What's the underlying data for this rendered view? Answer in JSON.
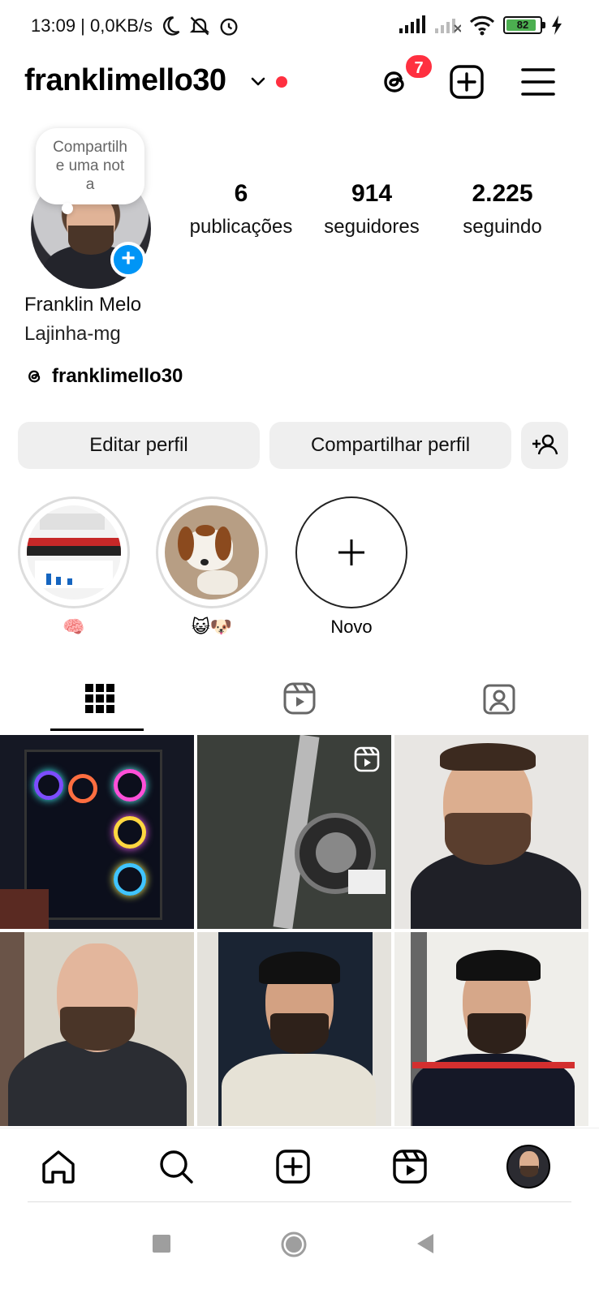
{
  "status_bar": {
    "time_speed": "13:09 | 0,0KB/s",
    "battery_level": "82"
  },
  "header": {
    "username": "franklimello30",
    "threads_badge_count": "7"
  },
  "note": {
    "placeholder": "Compartilhe uma nota"
  },
  "stats": [
    {
      "value": "6",
      "label": "publicações"
    },
    {
      "value": "914",
      "label": "seguidores"
    },
    {
      "value": "2.225",
      "label": "seguindo"
    }
  ],
  "profile": {
    "full_name": "Franklin Melo",
    "bio": "Lajinha-mg",
    "threads_handle": "franklimello30"
  },
  "buttons": {
    "edit": "Editar perfil",
    "share": "Compartilhar perfil"
  },
  "highlights": [
    {
      "caption": "🧠"
    },
    {
      "caption": "😺🐶"
    },
    {
      "caption": "Novo"
    }
  ],
  "tabs": [
    "grid-tab",
    "reels-tab",
    "tagged-tab"
  ],
  "colors": {
    "accent_blue": "#0095f6",
    "badge_red": "#ff3040",
    "button_bg": "#efefef"
  }
}
